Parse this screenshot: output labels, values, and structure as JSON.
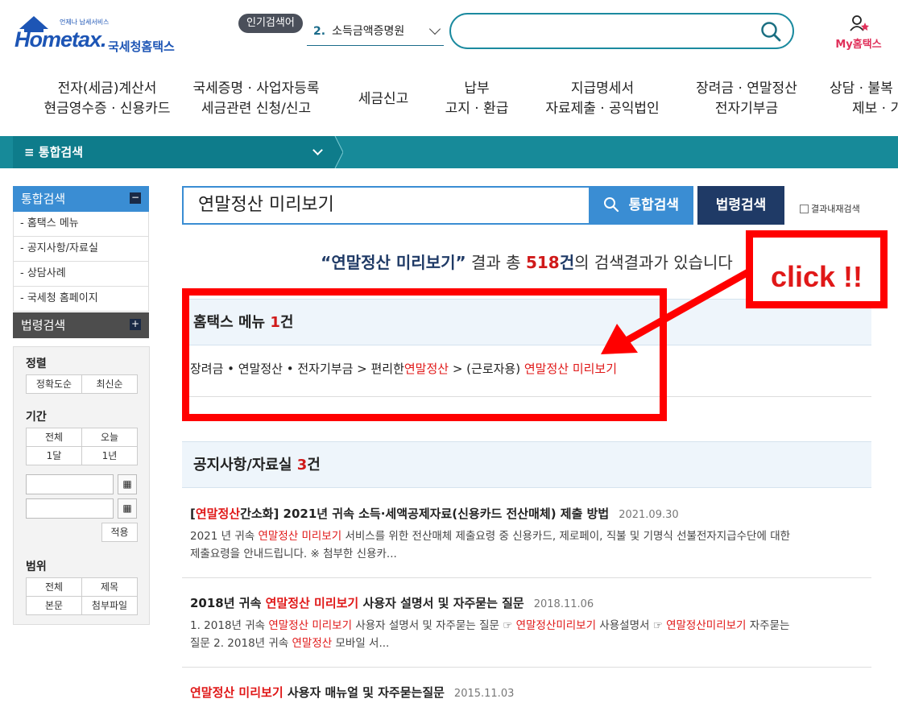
{
  "header": {
    "brand": "Hometax.",
    "tagline": "언제나 납세서비스",
    "brand_kr": "국세청홈택스",
    "popular_badge": "인기검색어",
    "popular_rank": "2.",
    "popular_term": "소득금액증명원",
    "my_label": "My홈택스"
  },
  "nav": {
    "items": [
      {
        "line1": "전자(세금)계산서",
        "line2": "현금영수증 · 신용카드"
      },
      {
        "line1": "국세증명 · 사업자등록",
        "line2": "세금관련 신청/신고"
      },
      {
        "line1": "세금신고",
        "line2": ""
      },
      {
        "line1": "납부",
        "line2": "고지 · 환급"
      },
      {
        "line1": "지급명세서",
        "line2": "자료제출 · 공익법인"
      },
      {
        "line1": "장려금 · 연말정산",
        "line2": "전자기부금"
      },
      {
        "line1": "상담 · 불복",
        "line2": "제보 · 기"
      }
    ]
  },
  "breadcrumb": {
    "label": "≡  통합검색"
  },
  "sidebar": {
    "head1": "통합검색",
    "toggle1": "−",
    "items": [
      "- 홈택스 메뉴",
      "- 공지사항/자료실",
      "- 상담사례",
      "- 국세청 홈페이지"
    ],
    "head2": "법령검색",
    "toggle2": "+",
    "sort_title": "정렬",
    "sort_options": [
      "정확도순",
      "최신순"
    ],
    "period_title": "기간",
    "period_options": [
      "전체",
      "오늘",
      "1달",
      "1년"
    ],
    "apply": "적용",
    "scope_title": "범위",
    "scope_options": [
      "전체",
      "제목",
      "본문",
      "첨부파일"
    ]
  },
  "search": {
    "query": "연말정산 미리보기",
    "integrated_btn": "통합검색",
    "law_btn": "법령검색",
    "within_label": "결과내재검색"
  },
  "summary": {
    "open_quote": "“",
    "query": "연말정산 미리보기",
    "close_quote": "”",
    "pre": " 결과 총 ",
    "count": "518",
    "unit": "건",
    "post": "의 검색결과가 있습니다"
  },
  "menu_section": {
    "title": "홈택스 메뉴 ",
    "count": "1",
    "unit": "건",
    "path_a": "장려금 • 연말정산 • 전자기부금 > 편리한",
    "path_b": "연말정산",
    "path_c": " > (근로자용) ",
    "path_d": "연말정산 미리보기"
  },
  "notice_section": {
    "title": "공지사항/자료실 ",
    "count": "3",
    "unit": "건",
    "posts": [
      {
        "t_open": "[",
        "t_red": "연말정산",
        "t_rest": "간소화] 2021년 귀속 소득·세액공제자료(신용카드 전산매체) 제출 방법",
        "date": "2021.09.30",
        "b1": "2021 년 귀속 ",
        "b1r": "연말정산 미리보기",
        "b1c": " 서비스를 위한 전산매체 제출요령 중 신용카드, 제로페이, 직불 및 기명식 선불전자지급수단에 대한",
        "b2": "제출요령을 안내드립니다. ※ 첨부한 신용카..."
      },
      {
        "t_pre": "2018년 귀속 ",
        "t_red": "연말정산 미리보기",
        "t_rest": " 사용자 설명서 및 자주묻는 질문",
        "date": "2018.11.06",
        "b1": "1. 2018년 귀속 ",
        "b1r": "연말정산 미리보기",
        "b1c": " 사용자 설명서 및 자주묻는 질문 ☞ ",
        "b1r2": "연말정산미리보기",
        "b1d": " 사용설명서 ☞ ",
        "b1r3": "연말정산미리보기",
        "b1e": " 자주묻는",
        "b2": "질문 2. 2018년 귀속 ",
        "b2r": "연말정산",
        "b2c": " 모바일 서..."
      },
      {
        "t_red": "연말정산 미리보기",
        "t_rest": " 사용자 매뉴얼 및 자주묻는질문",
        "date": "2015.11.03"
      }
    ]
  },
  "annotation": {
    "click_text": "click !!",
    "color": "#ff0000"
  },
  "colors": {
    "teal": "#178a99",
    "blue": "#3a8dd3",
    "navy": "#1f3a66",
    "red": "#d01a1a"
  }
}
